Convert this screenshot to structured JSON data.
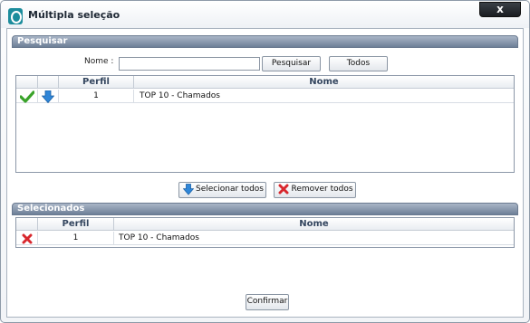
{
  "window": {
    "title": "Múltipla seleção",
    "close_label": "x"
  },
  "search": {
    "header": "Pesquisar",
    "name_label": "Nome :",
    "name_value": "",
    "search_button": "Pesquisar",
    "all_button": "Todos",
    "columns": [
      "Perfil",
      "Nome"
    ],
    "rows": [
      {
        "perfil": "1",
        "nome": "TOP 10 - Chamados"
      }
    ]
  },
  "actions": {
    "select_all": "Selecionar todos",
    "remove_all": "Remover todos"
  },
  "selected": {
    "header": "Selecionados",
    "columns": [
      "Perfil",
      "Nome"
    ],
    "rows": [
      {
        "perfil": "1",
        "nome": "TOP 10 - Chamados"
      }
    ]
  },
  "confirm_button": "Confirmar",
  "icons": {
    "app": "app-logo-icon",
    "confirm_row": "check-icon",
    "move_down": "arrow-down-icon",
    "remove": "red-x-icon"
  },
  "colors": {
    "header_blue": "#6d7f97",
    "check_green": "#3aa32a",
    "arrow_blue": "#2f86d8",
    "remove_red": "#d8272d"
  }
}
